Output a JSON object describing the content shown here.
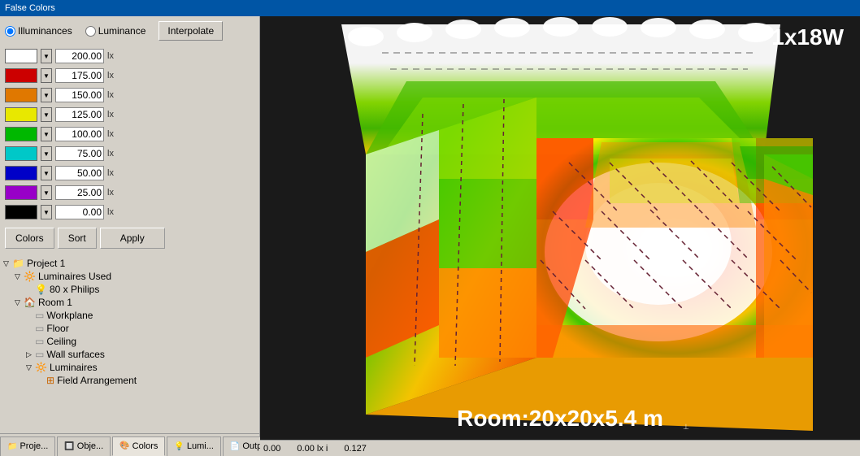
{
  "titleBar": {
    "label": "False Colors"
  },
  "leftPanel": {
    "radioOptions": [
      {
        "id": "illuminances",
        "label": "Illuminances",
        "checked": true
      },
      {
        "id": "luminance",
        "label": "Luminance",
        "checked": false
      }
    ],
    "interpolateBtn": "Interpolate",
    "colorRows": [
      {
        "swatch": "white",
        "value": "200.00",
        "unit": "lx"
      },
      {
        "swatch": "red",
        "value": "175.00",
        "unit": "lx"
      },
      {
        "swatch": "orange",
        "value": "150.00",
        "unit": "lx"
      },
      {
        "swatch": "yellow",
        "value": "125.00",
        "unit": "lx"
      },
      {
        "swatch": "green",
        "value": "100.00",
        "unit": "lx"
      },
      {
        "swatch": "cyan",
        "value": "75.00",
        "unit": "lx"
      },
      {
        "swatch": "blue",
        "value": "50.00",
        "unit": "lx"
      },
      {
        "swatch": "purple",
        "value": "25.00",
        "unit": "lx"
      },
      {
        "swatch": "black",
        "value": "0.00",
        "unit": "lx"
      }
    ],
    "colorsBtn": "Colors",
    "sortBtn": "Sort",
    "applyBtn": "Apply"
  },
  "treePanel": {
    "items": [
      {
        "label": "Project 1",
        "indent": 1,
        "expanded": true,
        "icon": "folder"
      },
      {
        "label": "Luminaires Used",
        "indent": 2,
        "expanded": true,
        "icon": "luminaires"
      },
      {
        "label": "80 x Philips",
        "indent": 3,
        "expanded": false,
        "icon": "luminaire-item"
      },
      {
        "label": "Room 1",
        "indent": 2,
        "expanded": true,
        "icon": "room"
      },
      {
        "label": "Workplane",
        "indent": 3,
        "expanded": false,
        "icon": "workplane"
      },
      {
        "label": "Floor",
        "indent": 3,
        "expanded": false,
        "icon": "floor"
      },
      {
        "label": "Ceiling",
        "indent": 3,
        "expanded": false,
        "icon": "ceiling"
      },
      {
        "label": "Wall surfaces",
        "indent": 3,
        "expanded": false,
        "icon": "walls"
      },
      {
        "label": "Luminaires",
        "indent": 3,
        "expanded": true,
        "icon": "luminaires2"
      },
      {
        "label": "Field Arrangement",
        "indent": 4,
        "expanded": false,
        "icon": "field"
      }
    ]
  },
  "bottomTabs": [
    {
      "label": "Proje...",
      "icon": "project-icon",
      "active": false
    },
    {
      "label": "Obje...",
      "icon": "object-icon",
      "active": false
    },
    {
      "label": "Colors",
      "icon": "colors-icon",
      "active": true
    },
    {
      "label": "Lumi...",
      "icon": "lumi-icon",
      "active": false
    },
    {
      "label": "Output",
      "icon": "output-icon",
      "active": false
    }
  ],
  "visualization": {
    "title": "1x18W",
    "subtitle": "Room:20x20x5.4 m"
  },
  "statusBar": {
    "values": [
      "0.00",
      "0.00 lx i",
      "0.127"
    ]
  }
}
